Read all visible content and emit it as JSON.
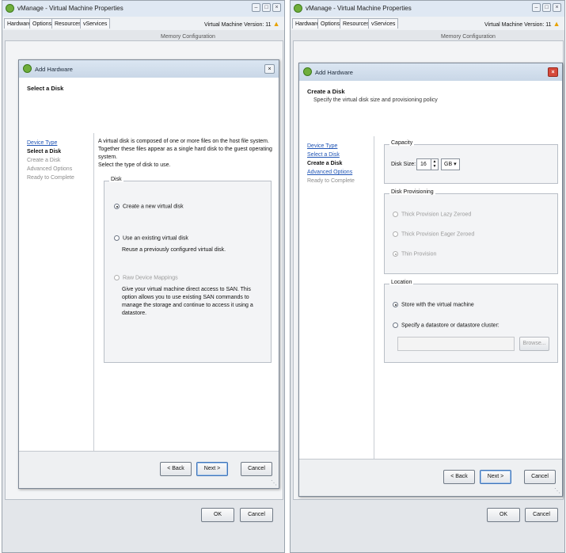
{
  "left_window": {
    "title": "vManage - Virtual Machine Properties",
    "tabs": [
      "Hardware",
      "Options",
      "Resources",
      "vServices"
    ],
    "version_text": "Virtual Machine Version: 11",
    "bg_label": "Memory Configuration",
    "dialog": {
      "title": "Add Hardware",
      "header_title": "Select a Disk",
      "nav_items": [
        "Device Type",
        "Select a Disk",
        "Create a Disk",
        "Advanced Options",
        "Ready to Complete"
      ],
      "intro_text": "A virtual disk is composed of one or more files on the host file system. Together these files appear as a single hard disk to the guest operating system.",
      "select_prompt": "Select the type of disk to use.",
      "group_label": "Disk",
      "options": [
        {
          "label": "Create a new virtual disk",
          "description": ""
        },
        {
          "label": "Use an existing virtual disk",
          "description": "Reuse a previously configured virtual disk."
        },
        {
          "label": "Raw Device Mappings",
          "description": "Give your virtual machine direct access to SAN. This option allows you to use existing SAN commands to manage the storage and continue to access it using a datastore."
        }
      ],
      "buttons": {
        "back": "< Back",
        "next": "Next >",
        "cancel": "Cancel"
      }
    },
    "bottom_buttons": {
      "ok": "OK",
      "cancel": "Cancel"
    }
  },
  "right_window": {
    "title": "vManage - Virtual Machine Properties",
    "tabs": [
      "Hardware",
      "Options",
      "Resources",
      "vServices"
    ],
    "version_text": "Virtual Machine Version: 11",
    "bg_label": "Memory Configuration",
    "dialog": {
      "title": "Add Hardware",
      "header_title": "Create a Disk",
      "header_subtitle": "Specify the virtual disk size and provisioning policy",
      "nav_items": [
        "Device Type",
        "Select a Disk",
        "Create a Disk",
        "Advanced Options",
        "Ready to Complete"
      ],
      "capacity": {
        "group_label": "Capacity",
        "label": "Disk Size:",
        "value": "16",
        "unit": "GB"
      },
      "provisioning": {
        "group_label": "Disk Provisioning",
        "options": [
          "Thick Provision Lazy Zeroed",
          "Thick Provision Eager Zeroed",
          "Thin Provision"
        ]
      },
      "location": {
        "group_label": "Location",
        "options": [
          "Store with the virtual machine",
          "Specify a datastore or datastore cluster:"
        ],
        "browse_label": "Browse..."
      },
      "buttons": {
        "back": "< Back",
        "next": "Next >",
        "cancel": "Cancel"
      }
    },
    "bottom_buttons": {
      "ok": "OK",
      "cancel": "Cancel"
    }
  }
}
